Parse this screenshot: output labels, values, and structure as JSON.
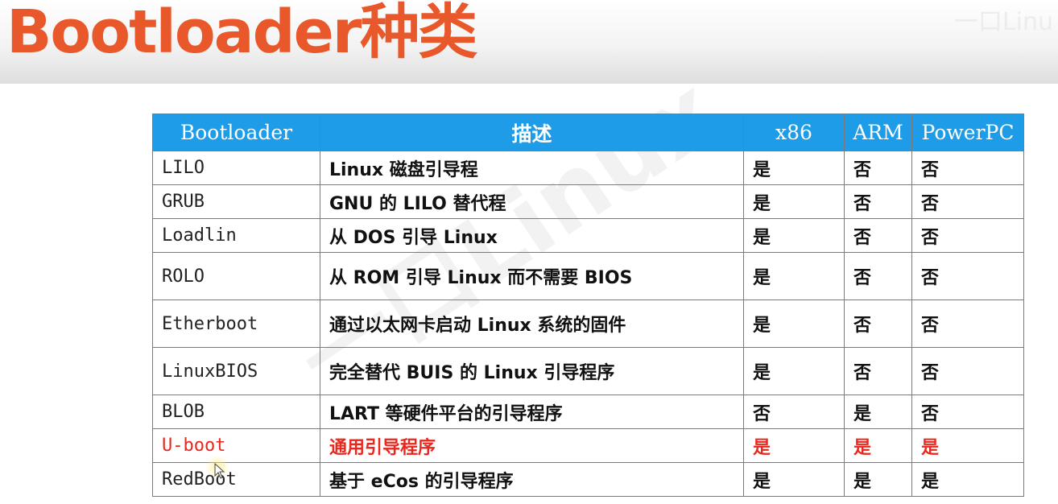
{
  "slide": {
    "title": "Bootloader种类",
    "corner_mark": "一口Linu",
    "watermark": "一口Linux"
  },
  "table": {
    "headers": [
      "Bootloader",
      "描述",
      "x86",
      "ARM",
      "PowerPC"
    ],
    "rows": [
      {
        "name": "LILO",
        "desc": "Linux 磁盘引导程",
        "x86": "是",
        "arm": "否",
        "ppc": "否"
      },
      {
        "name": "GRUB",
        "desc": "GNU 的 LILO 替代程",
        "x86": "是",
        "arm": "否",
        "ppc": "否"
      },
      {
        "name": "Loadlin",
        "desc": "从 DOS 引导 Linux",
        "x86": "是",
        "arm": "否",
        "ppc": "否"
      },
      {
        "name": "ROLO",
        "desc": "从 ROM 引导 Linux 而不需要 BIOS",
        "x86": "是",
        "arm": "否",
        "ppc": "否"
      },
      {
        "name": "Etherboot",
        "desc": "通过以太网卡启动 Linux 系统的固件",
        "x86": "是",
        "arm": "否",
        "ppc": "否"
      },
      {
        "name": "LinuxBIOS",
        "desc": "完全替代 BUIS 的 Linux 引导程序",
        "x86": "是",
        "arm": "否",
        "ppc": "否"
      },
      {
        "name": "BLOB",
        "desc": "LART 等硬件平台的引导程序",
        "x86": "否",
        "arm": "是",
        "ppc": "否"
      },
      {
        "name": "U-boot",
        "desc": "通用引导程序",
        "x86": "是",
        "arm": "是",
        "ppc": "是"
      },
      {
        "name": "RedBoot",
        "desc": "基于 eCos 的引导程序",
        "x86": "是",
        "arm": "是",
        "ppc": "是"
      }
    ]
  },
  "colors": {
    "title": "#e8582a",
    "header_bg": "#1e9ce8",
    "highlight_row": "#e8271e"
  }
}
